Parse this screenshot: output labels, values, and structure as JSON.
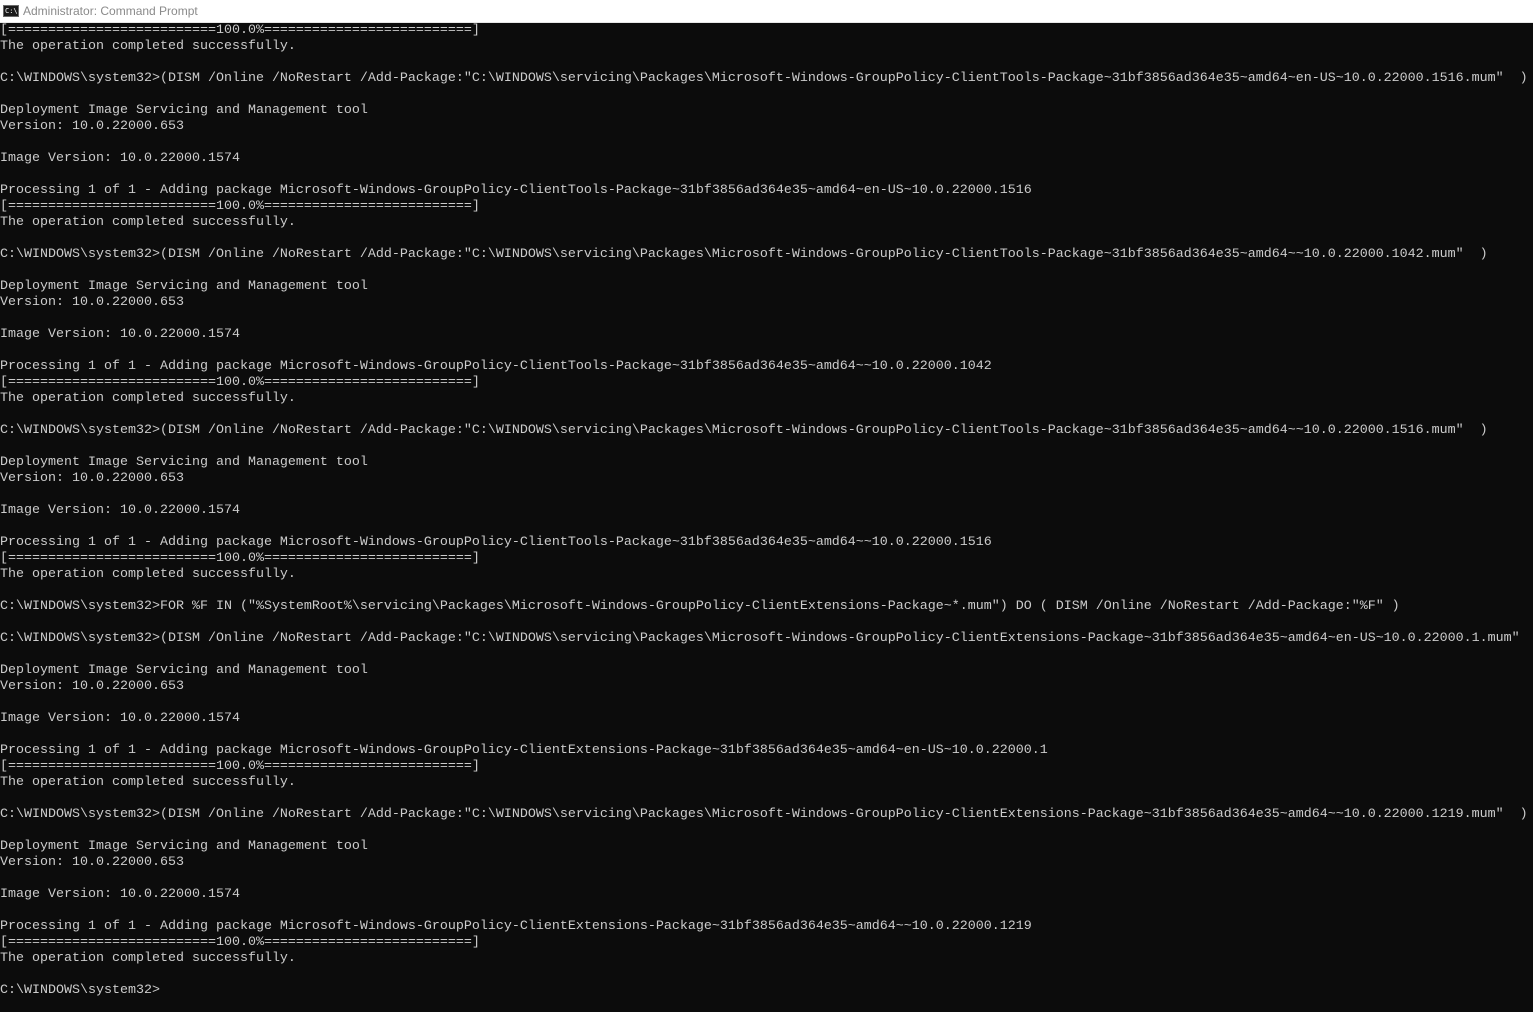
{
  "window": {
    "title": "Administrator: Command Prompt",
    "icon_text": "C:\\"
  },
  "console": {
    "lines": [
      "[==========================100.0%==========================]",
      "The operation completed successfully.",
      "",
      "C:\\WINDOWS\\system32>(DISM /Online /NoRestart /Add-Package:\"C:\\WINDOWS\\servicing\\Packages\\Microsoft-Windows-GroupPolicy-ClientTools-Package~31bf3856ad364e35~amd64~en-US~10.0.22000.1516.mum\"  )",
      "",
      "Deployment Image Servicing and Management tool",
      "Version: 10.0.22000.653",
      "",
      "Image Version: 10.0.22000.1574",
      "",
      "Processing 1 of 1 - Adding package Microsoft-Windows-GroupPolicy-ClientTools-Package~31bf3856ad364e35~amd64~en-US~10.0.22000.1516",
      "[==========================100.0%==========================]",
      "The operation completed successfully.",
      "",
      "C:\\WINDOWS\\system32>(DISM /Online /NoRestart /Add-Package:\"C:\\WINDOWS\\servicing\\Packages\\Microsoft-Windows-GroupPolicy-ClientTools-Package~31bf3856ad364e35~amd64~~10.0.22000.1042.mum\"  )",
      "",
      "Deployment Image Servicing and Management tool",
      "Version: 10.0.22000.653",
      "",
      "Image Version: 10.0.22000.1574",
      "",
      "Processing 1 of 1 - Adding package Microsoft-Windows-GroupPolicy-ClientTools-Package~31bf3856ad364e35~amd64~~10.0.22000.1042",
      "[==========================100.0%==========================]",
      "The operation completed successfully.",
      "",
      "C:\\WINDOWS\\system32>(DISM /Online /NoRestart /Add-Package:\"C:\\WINDOWS\\servicing\\Packages\\Microsoft-Windows-GroupPolicy-ClientTools-Package~31bf3856ad364e35~amd64~~10.0.22000.1516.mum\"  )",
      "",
      "Deployment Image Servicing and Management tool",
      "Version: 10.0.22000.653",
      "",
      "Image Version: 10.0.22000.1574",
      "",
      "Processing 1 of 1 - Adding package Microsoft-Windows-GroupPolicy-ClientTools-Package~31bf3856ad364e35~amd64~~10.0.22000.1516",
      "[==========================100.0%==========================]",
      "The operation completed successfully.",
      "",
      "C:\\WINDOWS\\system32>FOR %F IN (\"%SystemRoot%\\servicing\\Packages\\Microsoft-Windows-GroupPolicy-ClientExtensions-Package~*.mum\") DO ( DISM /Online /NoRestart /Add-Package:\"%F\" )",
      "",
      "C:\\WINDOWS\\system32>(DISM /Online /NoRestart /Add-Package:\"C:\\WINDOWS\\servicing\\Packages\\Microsoft-Windows-GroupPolicy-ClientExtensions-Package~31bf3856ad364e35~amd64~en-US~10.0.22000.1.mum\"",
      "",
      "Deployment Image Servicing and Management tool",
      "Version: 10.0.22000.653",
      "",
      "Image Version: 10.0.22000.1574",
      "",
      "Processing 1 of 1 - Adding package Microsoft-Windows-GroupPolicy-ClientExtensions-Package~31bf3856ad364e35~amd64~en-US~10.0.22000.1",
      "[==========================100.0%==========================]",
      "The operation completed successfully.",
      "",
      "C:\\WINDOWS\\system32>(DISM /Online /NoRestart /Add-Package:\"C:\\WINDOWS\\servicing\\Packages\\Microsoft-Windows-GroupPolicy-ClientExtensions-Package~31bf3856ad364e35~amd64~~10.0.22000.1219.mum\"  )",
      "",
      "Deployment Image Servicing and Management tool",
      "Version: 10.0.22000.653",
      "",
      "Image Version: 10.0.22000.1574",
      "",
      "Processing 1 of 1 - Adding package Microsoft-Windows-GroupPolicy-ClientExtensions-Package~31bf3856ad364e35~amd64~~10.0.22000.1219",
      "[==========================100.0%==========================]",
      "The operation completed successfully.",
      "",
      "C:\\WINDOWS\\system32>"
    ]
  }
}
